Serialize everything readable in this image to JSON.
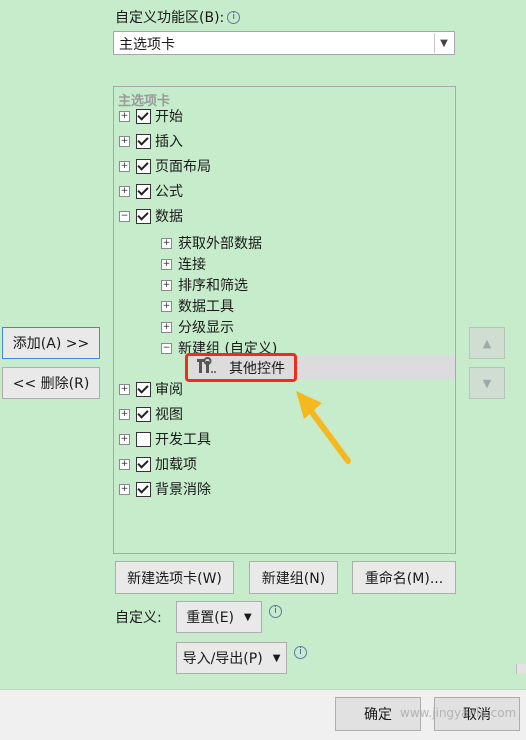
{
  "custom_ribbon_label": "自定义功能区(B):",
  "custom_ribbon_select": "主选项卡",
  "tree_header": "主选项卡",
  "tree": {
    "start": "开始",
    "insert": "插入",
    "page_layout": "页面布局",
    "formulas": "公式",
    "data": "数据",
    "get_external": "获取外部数据",
    "connections": "连接",
    "sort_filter": "排序和筛选",
    "data_tools": "数据工具",
    "outline": "分级显示",
    "new_group": "新建组 (自定义)",
    "other_controls": "其他控件",
    "review": "审阅",
    "view": "视图",
    "developer": "开发工具",
    "addins": "加载项",
    "bg_removal": "背景消除"
  },
  "buttons": {
    "add": "添加(A) >>",
    "remove": "<< 删除(R)",
    "new_tab": "新建选项卡(W)",
    "new_group": "新建组(N)",
    "rename": "重命名(M)...",
    "reset": "重置(E)",
    "import_export": "导入/导出(P)",
    "ok": "确定",
    "cancel": "取消"
  },
  "customize_label": "自定义:",
  "watermark": "www.jingyanla.com"
}
